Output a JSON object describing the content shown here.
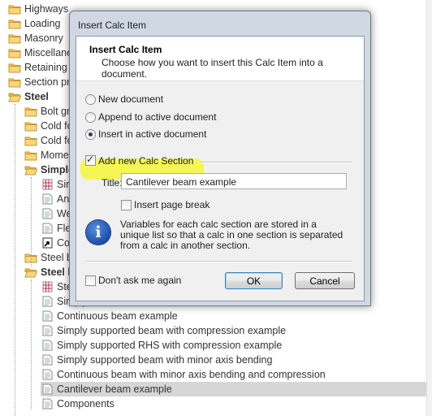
{
  "tree": {
    "items": [
      {
        "label": "Highways",
        "icon": "folder-icon",
        "bold": false
      },
      {
        "label": "Loading",
        "icon": "folder-icon",
        "bold": false
      },
      {
        "label": "Masonry",
        "icon": "folder-icon",
        "bold": false
      },
      {
        "label": "Miscellane",
        "icon": "folder-icon",
        "bold": false
      },
      {
        "label": "Retaining",
        "icon": "folder-icon",
        "bold": false
      },
      {
        "label": "Section pr",
        "icon": "folder-icon",
        "bold": false
      },
      {
        "label": "Steel",
        "icon": "folder-open-icon",
        "bold": true
      },
      {
        "label": "Bolt gr",
        "icon": "folder-icon",
        "bold": false
      },
      {
        "label": "Cold fo",
        "icon": "folder-icon",
        "bold": false
      },
      {
        "label": "Cold fo",
        "icon": "folder-icon",
        "bold": false
      },
      {
        "label": "Mome",
        "icon": "folder-icon",
        "bold": false
      },
      {
        "label": "Simple",
        "icon": "folder-open-icon",
        "bold": true
      },
      {
        "label": "Sim",
        "icon": "calc-grid-icon",
        "bold": false
      },
      {
        "label": "An",
        "icon": "document-icon",
        "bold": false
      },
      {
        "label": "We",
        "icon": "document-icon",
        "bold": false
      },
      {
        "label": "Fle",
        "icon": "document-icon",
        "bold": false
      },
      {
        "label": "Co",
        "icon": "shortcut-icon",
        "bold": false
      },
      {
        "label": "Steel b",
        "icon": "folder-icon",
        "bold": false
      },
      {
        "label": "Steel b",
        "icon": "folder-open-icon",
        "bold": true
      },
      {
        "label": "Ste",
        "icon": "calc-grid-icon",
        "bold": false
      },
      {
        "label": "Simply",
        "icon": "document-icon",
        "bold": false
      },
      {
        "label": "Continuous beam example",
        "icon": "document-icon",
        "bold": false
      },
      {
        "label": "Simply supported beam with compression example",
        "icon": "document-icon",
        "bold": false
      },
      {
        "label": "Simply supported RHS with compression example",
        "icon": "document-icon",
        "bold": false
      },
      {
        "label": "Simply supported beam with minor axis bending",
        "icon": "document-icon",
        "bold": false
      },
      {
        "label": "Continuous beam with minor axis bending and compression",
        "icon": "document-icon",
        "bold": false
      },
      {
        "label": "Cantilever beam example",
        "icon": "document-icon",
        "bold": false,
        "selected": true
      },
      {
        "label": "Components",
        "icon": "document-icon",
        "bold": false
      }
    ]
  },
  "dialog": {
    "window_title": "Insert Calc Item",
    "header_title": "Insert Calc Item",
    "header_subtitle": "Choose how you want to insert this Calc Item into a document.",
    "options": [
      {
        "label": "New document",
        "checked": false
      },
      {
        "label": "Append to active document",
        "checked": false
      },
      {
        "label": "Insert in active document",
        "checked": true
      }
    ],
    "add_section_label": "Add new Calc Section",
    "add_section_checked": true,
    "title_label": "Title:",
    "title_value": "Cantilever beam example",
    "page_break_label": "Insert page break",
    "page_break_checked": false,
    "info_text": "Variables for each calc section are stored in a unique list so that a calc in one section is separated from a calc in another section.",
    "dont_ask_label": "Don't ask me again",
    "ok_label": "OK",
    "cancel_label": "Cancel",
    "highlight_color": "#f6f63a"
  }
}
